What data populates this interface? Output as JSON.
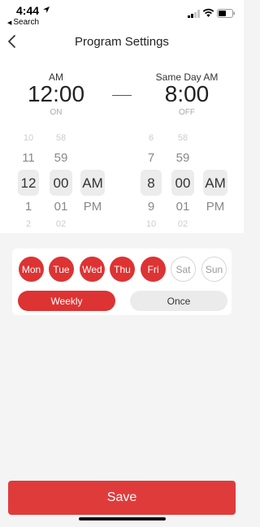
{
  "status_bar": {
    "time": "4:44",
    "back_app": "Search"
  },
  "nav": {
    "title": "Program Settings"
  },
  "summary": {
    "start": {
      "label": "AM",
      "time": "12:00",
      "state": "ON"
    },
    "end": {
      "label": "Same Day AM",
      "time": "8:00",
      "state": "OFF"
    }
  },
  "pickers": {
    "start": {
      "hours": [
        "10",
        "11",
        "12",
        "1",
        "2"
      ],
      "minutes": [
        "58",
        "59",
        "00",
        "01",
        "02"
      ],
      "ampm": [
        "",
        "",
        "AM",
        "PM",
        ""
      ]
    },
    "end": {
      "hours": [
        "6",
        "7",
        "8",
        "9",
        "10"
      ],
      "minutes": [
        "58",
        "59",
        "00",
        "01",
        "02"
      ],
      "ampm": [
        "",
        "",
        "AM",
        "PM",
        ""
      ]
    }
  },
  "days": [
    {
      "label": "Mon",
      "selected": true
    },
    {
      "label": "Tue",
      "selected": true
    },
    {
      "label": "Wed",
      "selected": true
    },
    {
      "label": "Thu",
      "selected": true
    },
    {
      "label": "Fri",
      "selected": true
    },
    {
      "label": "Sat",
      "selected": false
    },
    {
      "label": "Sun",
      "selected": false
    }
  ],
  "repeat": {
    "weekly_label": "Weekly",
    "once_label": "Once",
    "selected": "Weekly"
  },
  "save_label": "Save",
  "colors": {
    "accent": "#dd3333"
  }
}
